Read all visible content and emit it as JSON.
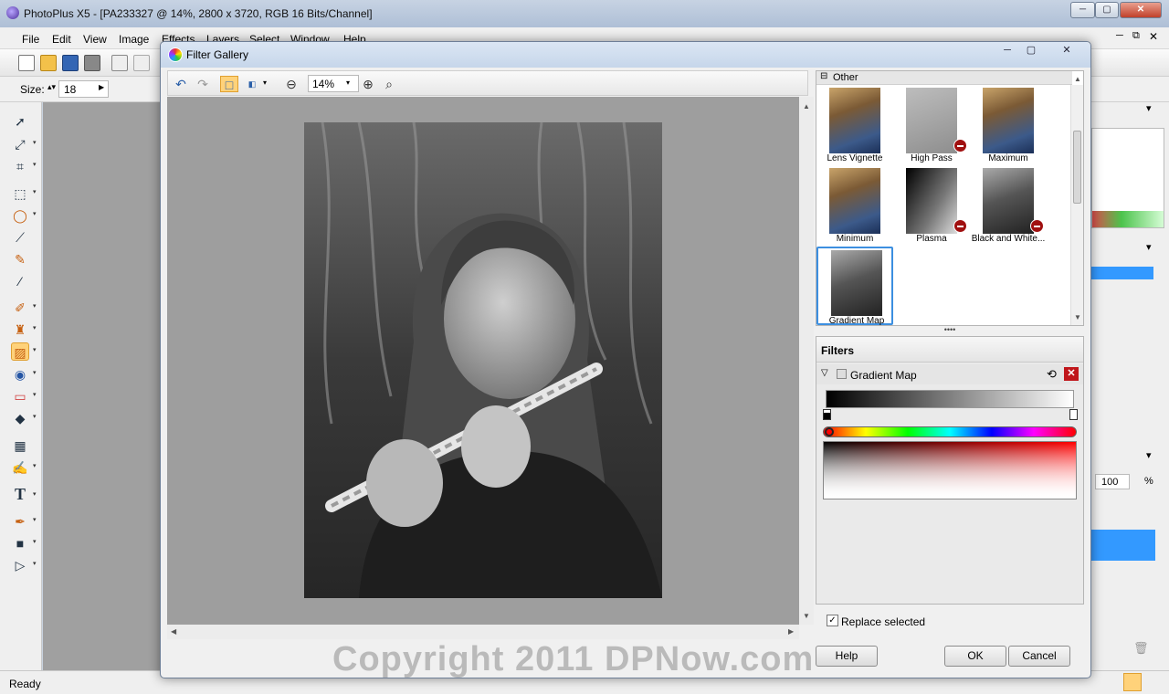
{
  "app": {
    "title": "PhotoPlus X5 - [PA233327 @ 14%, 2800 x 3720, RGB 16 Bits/Channel]",
    "window_buttons": [
      "─",
      "▢",
      "✕"
    ],
    "status": "Ready"
  },
  "menu": [
    "File",
    "Edit",
    "View",
    "Image",
    "Effects",
    "Layers",
    "Select",
    "Window",
    "Help"
  ],
  "toolbar2": {
    "size_label": "Size:",
    "size_value": "18"
  },
  "right_panel": {
    "opacity_value": "100",
    "opacity_unit": "%"
  },
  "dialog": {
    "title": "Filter Gallery",
    "window_buttons": [
      "─",
      "▢",
      "✕"
    ],
    "zoom": "14%",
    "category": "Other",
    "thumbnails": [
      {
        "label": "Lens Vignette",
        "style": "color",
        "unavailable": false,
        "selected": false
      },
      {
        "label": "High Pass",
        "style": "highpass",
        "unavailable": true,
        "selected": false
      },
      {
        "label": "Maximum",
        "style": "color",
        "unavailable": false,
        "selected": false
      },
      {
        "label": "Minimum",
        "style": "color",
        "unavailable": false,
        "selected": false
      },
      {
        "label": "Plasma",
        "style": "plasma",
        "unavailable": true,
        "selected": false
      },
      {
        "label": "Black and White...",
        "style": "gray",
        "unavailable": true,
        "selected": false
      },
      {
        "label": "Gradient Map",
        "style": "gray",
        "unavailable": false,
        "selected": true
      }
    ],
    "filters_header": "Filters",
    "active_filter": "Gradient Map",
    "replace_selected_label": "Replace selected",
    "replace_selected_checked": true,
    "buttons": {
      "help": "Help",
      "ok": "OK",
      "cancel": "Cancel"
    }
  },
  "watermark": "Copyright 2011 DPNow.com",
  "colors": {
    "accent_selection": "#3c8fe0",
    "tool_highlight": "#ffd27a",
    "remove_filter": "#c0161b"
  }
}
